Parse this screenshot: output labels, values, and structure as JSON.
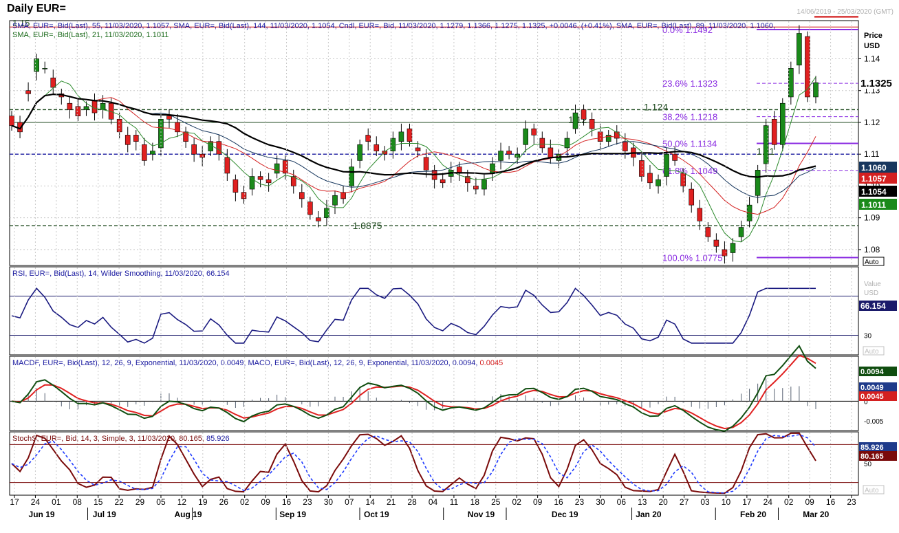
{
  "header": {
    "title": "Daily EUR=",
    "date_range": "14/06/2019 - 25/03/2020 (GMT)"
  },
  "x_axis": {
    "day_labels": [
      "17",
      "24",
      "01",
      "08",
      "15",
      "22",
      "29",
      "05",
      "12",
      "19",
      "26",
      "02",
      "09",
      "16",
      "23",
      "30",
      "07",
      "14",
      "21",
      "28",
      "04",
      "11",
      "18",
      "25",
      "02",
      "09",
      "16",
      "23",
      "30",
      "06",
      "13",
      "20",
      "27",
      "03",
      "10",
      "17",
      "24",
      "02",
      "09",
      "16",
      "23"
    ],
    "month_labels": [
      "Jun 19",
      "Jul 19",
      "Aug 19",
      "Sep 19",
      "Oct 19",
      "Nov 19",
      "Dec 19",
      "Jan 20",
      "Feb 20",
      "Mar 20"
    ]
  },
  "panels": {
    "price": {
      "legend_line1": "SMA, EUR=, Bid(Last), 55, 11/03/2020, 1.1057, SMA, EUR=, Bid(Last), 144, 11/03/2020, 1.1054, Cndl, EUR=, Bid, 11/03/2020, 1.1279, 1.1366, 1.1275, 1.1325, +0.0046, (+0.41%), SMA, EUR=, Bid(Last), 89, 11/03/2020, 1.1060,",
      "legend_line2": "SMA, EUR=, Bid(Last), 21, 11/03/2020, 1.1011",
      "axis_title": "Price",
      "axis_unit": "USD",
      "ticks": [
        "1.14",
        "1.13",
        "1.12",
        "1.11",
        "1.10",
        "1.09",
        "1.08"
      ],
      "last_price": "1.1325",
      "value_tags": [
        {
          "text": "1.1060",
          "bg": "#17375e"
        },
        {
          "text": "1.1057",
          "bg": "#d42020"
        },
        {
          "text": "1.1054",
          "bg": "#000000"
        },
        {
          "text": "1.1011",
          "bg": "#1a8a1a"
        }
      ],
      "auto_label": "Auto",
      "levels": [
        {
          "label": "1.15",
          "color": "#cc0000"
        },
        {
          "label": "1.124",
          "color": "#1f4a1f"
        },
        {
          "label": "1.12",
          "color": "#1f4a1f"
        },
        {
          "label": "1.11",
          "color": "#1f4a1f"
        },
        {
          "label": "1.0875",
          "color": "#1f4a1f"
        }
      ],
      "fib": [
        {
          "pct": "0.0%",
          "value": "1.1492"
        },
        {
          "pct": "23.6%",
          "value": "1.1323"
        },
        {
          "pct": "38.2%",
          "value": "1.1218"
        },
        {
          "pct": "50.0%",
          "value": "1.1134"
        },
        {
          "pct": "61.8%",
          "value": "1.1049"
        },
        {
          "pct": "100.0%",
          "value": "1.0775"
        }
      ]
    },
    "rsi": {
      "legend": "RSI, EUR=, Bid(Last), 14, Wilder Smoothing, 11/03/2020, 66.154",
      "axis_title": "Value",
      "axis_unit": "USD",
      "ticks": [
        "60",
        "30"
      ],
      "last_value": "66.154",
      "auto_label": "Auto"
    },
    "macd": {
      "legend_a": "MACDF, EUR=, Bid(Last), 12, 26, 9, Exponential, 11/03/2020, 0.0049, MACD, EUR=, Bid(Last), 12, 26, 9, Exponential, 11/03/2020, 0.0094,",
      "legend_b": "0.0045",
      "ticks": [
        "0",
        "-0.005"
      ],
      "tags": [
        {
          "text": "0.0094",
          "bg": "#0f4d0f"
        },
        {
          "text": "0.0049",
          "bg": "#1e3a8a"
        },
        {
          "text": "0.0045",
          "bg": "#d42020"
        }
      ]
    },
    "stoch": {
      "legend_a": "StochS, EUR=, Bid, 14, 3, Simple, 3, 11/03/2020, 80.165,",
      "legend_b": "85.926",
      "ticks": [
        "50"
      ],
      "tags": [
        {
          "text": "85.926",
          "bg": "#1e3a8a"
        },
        {
          "text": "80.165",
          "bg": "#7a0a0a"
        }
      ],
      "auto_label": "Auto"
    }
  },
  "chart_data": {
    "type": "candlestick",
    "instrument": "EUR=",
    "timeframe": "Daily",
    "y_range": [
      1.075,
      1.152
    ],
    "last_candle": {
      "date": "11/03/2020",
      "open": 1.1279,
      "high": 1.1366,
      "low": 1.1275,
      "close": 1.1325
    },
    "moving_averages": [
      {
        "name": "SMA 21",
        "color": "#2e8b2e",
        "last": 1.1011
      },
      {
        "name": "SMA 55",
        "color": "#d42020",
        "last": 1.1057
      },
      {
        "name": "SMA 89",
        "color": "#17375e",
        "last": 1.106
      },
      {
        "name": "SMA 144",
        "color": "#000000",
        "last": 1.1054
      }
    ],
    "price_path": [
      [
        1.122,
        1.119
      ],
      [
        1.12,
        1.117
      ],
      [
        1.13,
        1.129
      ],
      [
        1.136,
        1.14
      ],
      [
        1.137,
        1.137
      ],
      [
        1.134,
        1.131
      ],
      [
        1.129,
        1.128
      ],
      [
        1.126,
        1.124
      ],
      [
        1.125,
        1.122
      ],
      [
        1.124,
        1.125
      ],
      [
        1.127,
        1.123
      ],
      [
        1.124,
        1.126
      ],
      [
        1.126,
        1.121
      ],
      [
        1.121,
        1.117
      ],
      [
        1.116,
        1.113
      ],
      [
        1.116,
        1.114
      ],
      [
        1.113,
        1.108
      ],
      [
        1.11,
        1.111
      ],
      [
        1.112,
        1.121
      ],
      [
        1.122,
        1.121
      ],
      [
        1.12,
        1.117
      ],
      [
        1.117,
        1.114
      ],
      [
        1.113,
        1.11
      ],
      [
        1.11,
        1.109
      ],
      [
        1.111,
        1.114
      ],
      [
        1.114,
        1.11
      ],
      [
        1.109,
        1.104
      ],
      [
        1.102,
        1.098
      ],
      [
        1.098,
        1.096
      ],
      [
        1.099,
        1.103
      ],
      [
        1.103,
        1.102
      ],
      [
        1.102,
        1.101
      ],
      [
        1.104,
        1.107
      ],
      [
        1.108,
        1.104
      ],
      [
        1.103,
        1.1
      ],
      [
        1.098,
        1.096
      ],
      [
        1.095,
        1.091
      ],
      [
        1.09,
        1.089
      ],
      [
        1.09,
        1.093
      ],
      [
        1.094,
        1.097
      ],
      [
        1.098,
        1.096
      ],
      [
        1.1,
        1.106
      ],
      [
        1.108,
        1.113
      ],
      [
        1.116,
        1.114
      ],
      [
        1.113,
        1.111
      ],
      [
        1.111,
        1.11
      ],
      [
        1.111,
        1.115
      ],
      [
        1.114,
        1.117
      ],
      [
        1.118,
        1.114
      ],
      [
        1.112,
        1.111
      ],
      [
        1.109,
        1.105
      ],
      [
        1.105,
        1.102
      ],
      [
        1.102,
        1.101
      ],
      [
        1.103,
        1.105
      ],
      [
        1.106,
        1.104
      ],
      [
        1.103,
        1.101
      ],
      [
        1.1,
        1.099
      ],
      [
        1.099,
        1.102
      ],
      [
        1.104,
        1.107
      ],
      [
        1.108,
        1.111
      ],
      [
        1.111,
        1.11
      ],
      [
        1.109,
        1.11
      ],
      [
        1.113,
        1.118
      ],
      [
        1.118,
        1.116
      ],
      [
        1.115,
        1.112
      ],
      [
        1.112,
        1.109
      ],
      [
        1.108,
        1.11
      ],
      [
        1.112,
        1.115
      ],
      [
        1.118,
        1.123
      ],
      [
        1.124,
        1.121
      ],
      [
        1.121,
        1.118
      ],
      [
        1.117,
        1.114
      ],
      [
        1.114,
        1.116
      ],
      [
        1.117,
        1.115
      ],
      [
        1.114,
        1.111
      ],
      [
        1.112,
        1.109
      ],
      [
        1.108,
        1.103
      ],
      [
        1.104,
        1.101
      ],
      [
        1.1,
        1.102
      ],
      [
        1.103,
        1.11
      ],
      [
        1.11,
        1.108
      ],
      [
        1.104,
        1.1
      ],
      [
        1.099,
        1.094
      ],
      [
        1.093,
        1.089
      ],
      [
        1.087,
        1.084
      ],
      [
        1.083,
        1.081
      ],
      [
        1.08,
        1.078
      ],
      [
        1.079,
        1.082
      ],
      [
        1.084,
        1.087
      ],
      [
        1.089,
        1.094
      ],
      [
        1.097,
        1.105
      ],
      [
        1.107,
        1.119
      ],
      [
        1.121,
        1.113
      ],
      [
        1.113,
        1.126
      ],
      [
        1.128,
        1.137
      ],
      [
        1.138,
        1.148
      ],
      [
        1.147,
        1.128
      ],
      [
        1.128,
        1.1325
      ]
    ],
    "rsi": {
      "period": 14,
      "last": 66.154,
      "levels": [
        70,
        30
      ]
    },
    "macd": {
      "fast": 12,
      "slow": 26,
      "signal": 9,
      "histogram_last": 0.0049,
      "macd_last": 0.0094,
      "signal_last": 0.0045
    },
    "stochastic": {
      "period": 14,
      "k_last": 80.165,
      "d_last": 85.926,
      "levels": [
        80,
        20
      ]
    }
  }
}
